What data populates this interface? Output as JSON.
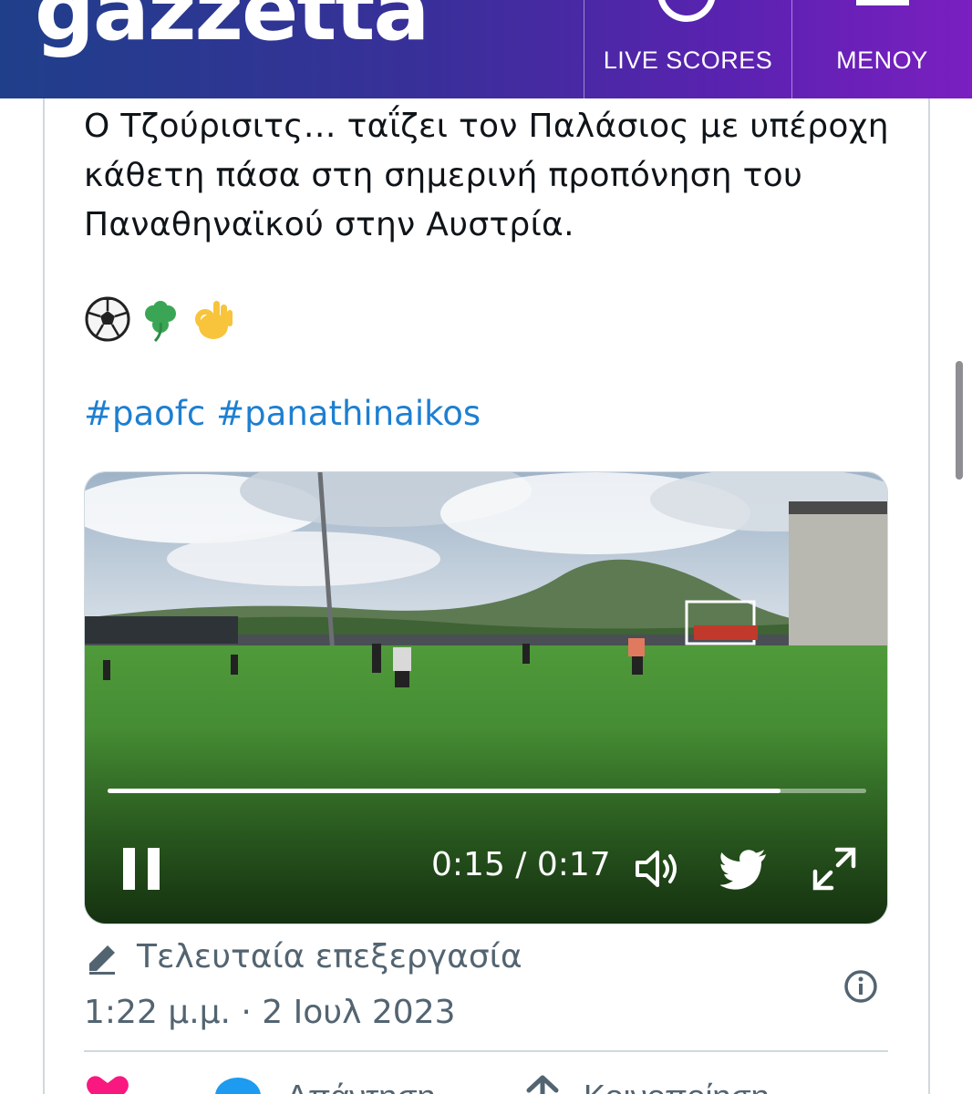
{
  "header": {
    "logo_text": "gazzetta",
    "live_scores_label": "LIVE SCORES",
    "menu_label": "ΜΕΝΟΥ",
    "gradient": [
      "#1f3f8a",
      "#7a1fc0"
    ]
  },
  "tweet": {
    "text": "Ο Τζούρισιτς… ταΐζει τον Παλάσιος με υπέροχη κάθετη πάσα στη σημερινή προπόνηση του Παναθηναϊκού στην Αυστρία.",
    "emojis": [
      "soccer-ball-icon",
      "shamrock-icon",
      "ok-hand-icon"
    ],
    "hashtags": [
      "#paofc",
      "#panathinaikos"
    ],
    "hashtag_color": "#1d7fd1"
  },
  "video": {
    "time": "0:15 / 0:17",
    "progress": 0.887,
    "controls": [
      "pause-icon",
      "volume-icon",
      "twitter-bird-icon",
      "fullscreen-icon"
    ]
  },
  "meta": {
    "edited_label": "Τελευταία επεξεργασία",
    "timestamp": "1:22 μ.μ. · 2 Ιουλ 2023",
    "text_color": "#536471"
  },
  "actions": [
    {
      "name": "like",
      "label": "",
      "color": "#f91880"
    },
    {
      "name": "reply",
      "label": "Απάντηση",
      "color": "#1d9bf0"
    },
    {
      "name": "share",
      "label": "Κοινοποίηση",
      "color": "#536471"
    }
  ]
}
